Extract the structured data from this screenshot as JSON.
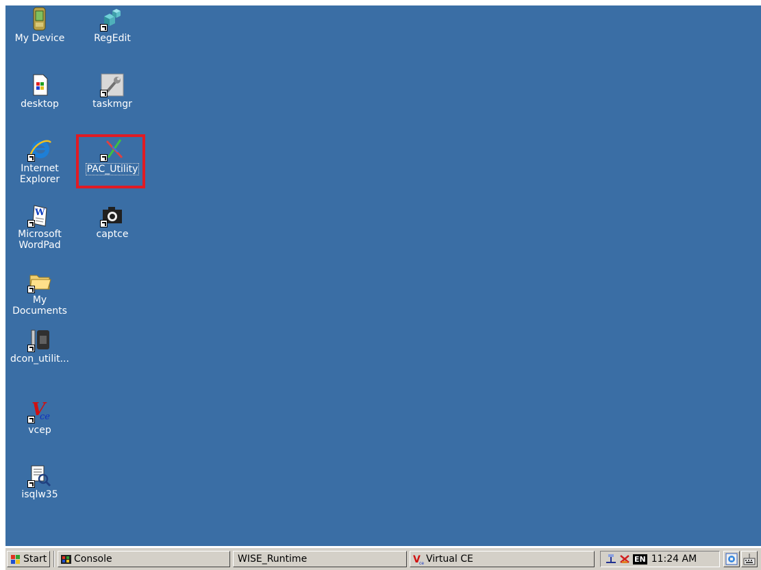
{
  "desktop": {
    "icons": [
      {
        "id": "my-device",
        "label": "My Device",
        "icon": "pda-device-icon"
      },
      {
        "id": "regedit",
        "label": "RegEdit",
        "icon": "registry-cubes-icon"
      },
      {
        "id": "desktop",
        "label": "desktop",
        "icon": "windows-document-icon"
      },
      {
        "id": "taskmgr",
        "label": "taskmgr",
        "icon": "wrench-icon"
      },
      {
        "id": "internet-explorer",
        "label": "Internet Explorer",
        "icon": "internet-explorer-icon"
      },
      {
        "id": "pac-utility",
        "label": "PAC_Utility",
        "icon": "pac-utility-icon"
      },
      {
        "id": "wordpad",
        "label": "Microsoft WordPad",
        "icon": "wordpad-icon"
      },
      {
        "id": "captce",
        "label": "captce",
        "icon": "camera-icon"
      },
      {
        "id": "my-documents",
        "label": "My Documents",
        "icon": "folder-icon"
      },
      {
        "id": "dcon-utility",
        "label": "dcon_utilit...",
        "icon": "dcon-module-icon"
      },
      {
        "id": "vcep",
        "label": "vcep",
        "icon": "vce-logo-icon"
      },
      {
        "id": "isqlw35",
        "label": "isqlw35",
        "icon": "sql-query-icon"
      }
    ]
  },
  "taskbar": {
    "start_label": "Start",
    "tasks": [
      {
        "label": "Console",
        "icon": "console-app-icon"
      },
      {
        "label": "WISE_Runtime",
        "icon": ""
      },
      {
        "label": "Virtual CE",
        "icon": "vce-small-icon"
      }
    ],
    "tray": {
      "language": "EN",
      "clock": "11:24 AM"
    }
  },
  "colors": {
    "desktop_bg": "#3a6ea5",
    "taskbar_bg": "#d4d0c8",
    "highlight": "#e01b24"
  }
}
